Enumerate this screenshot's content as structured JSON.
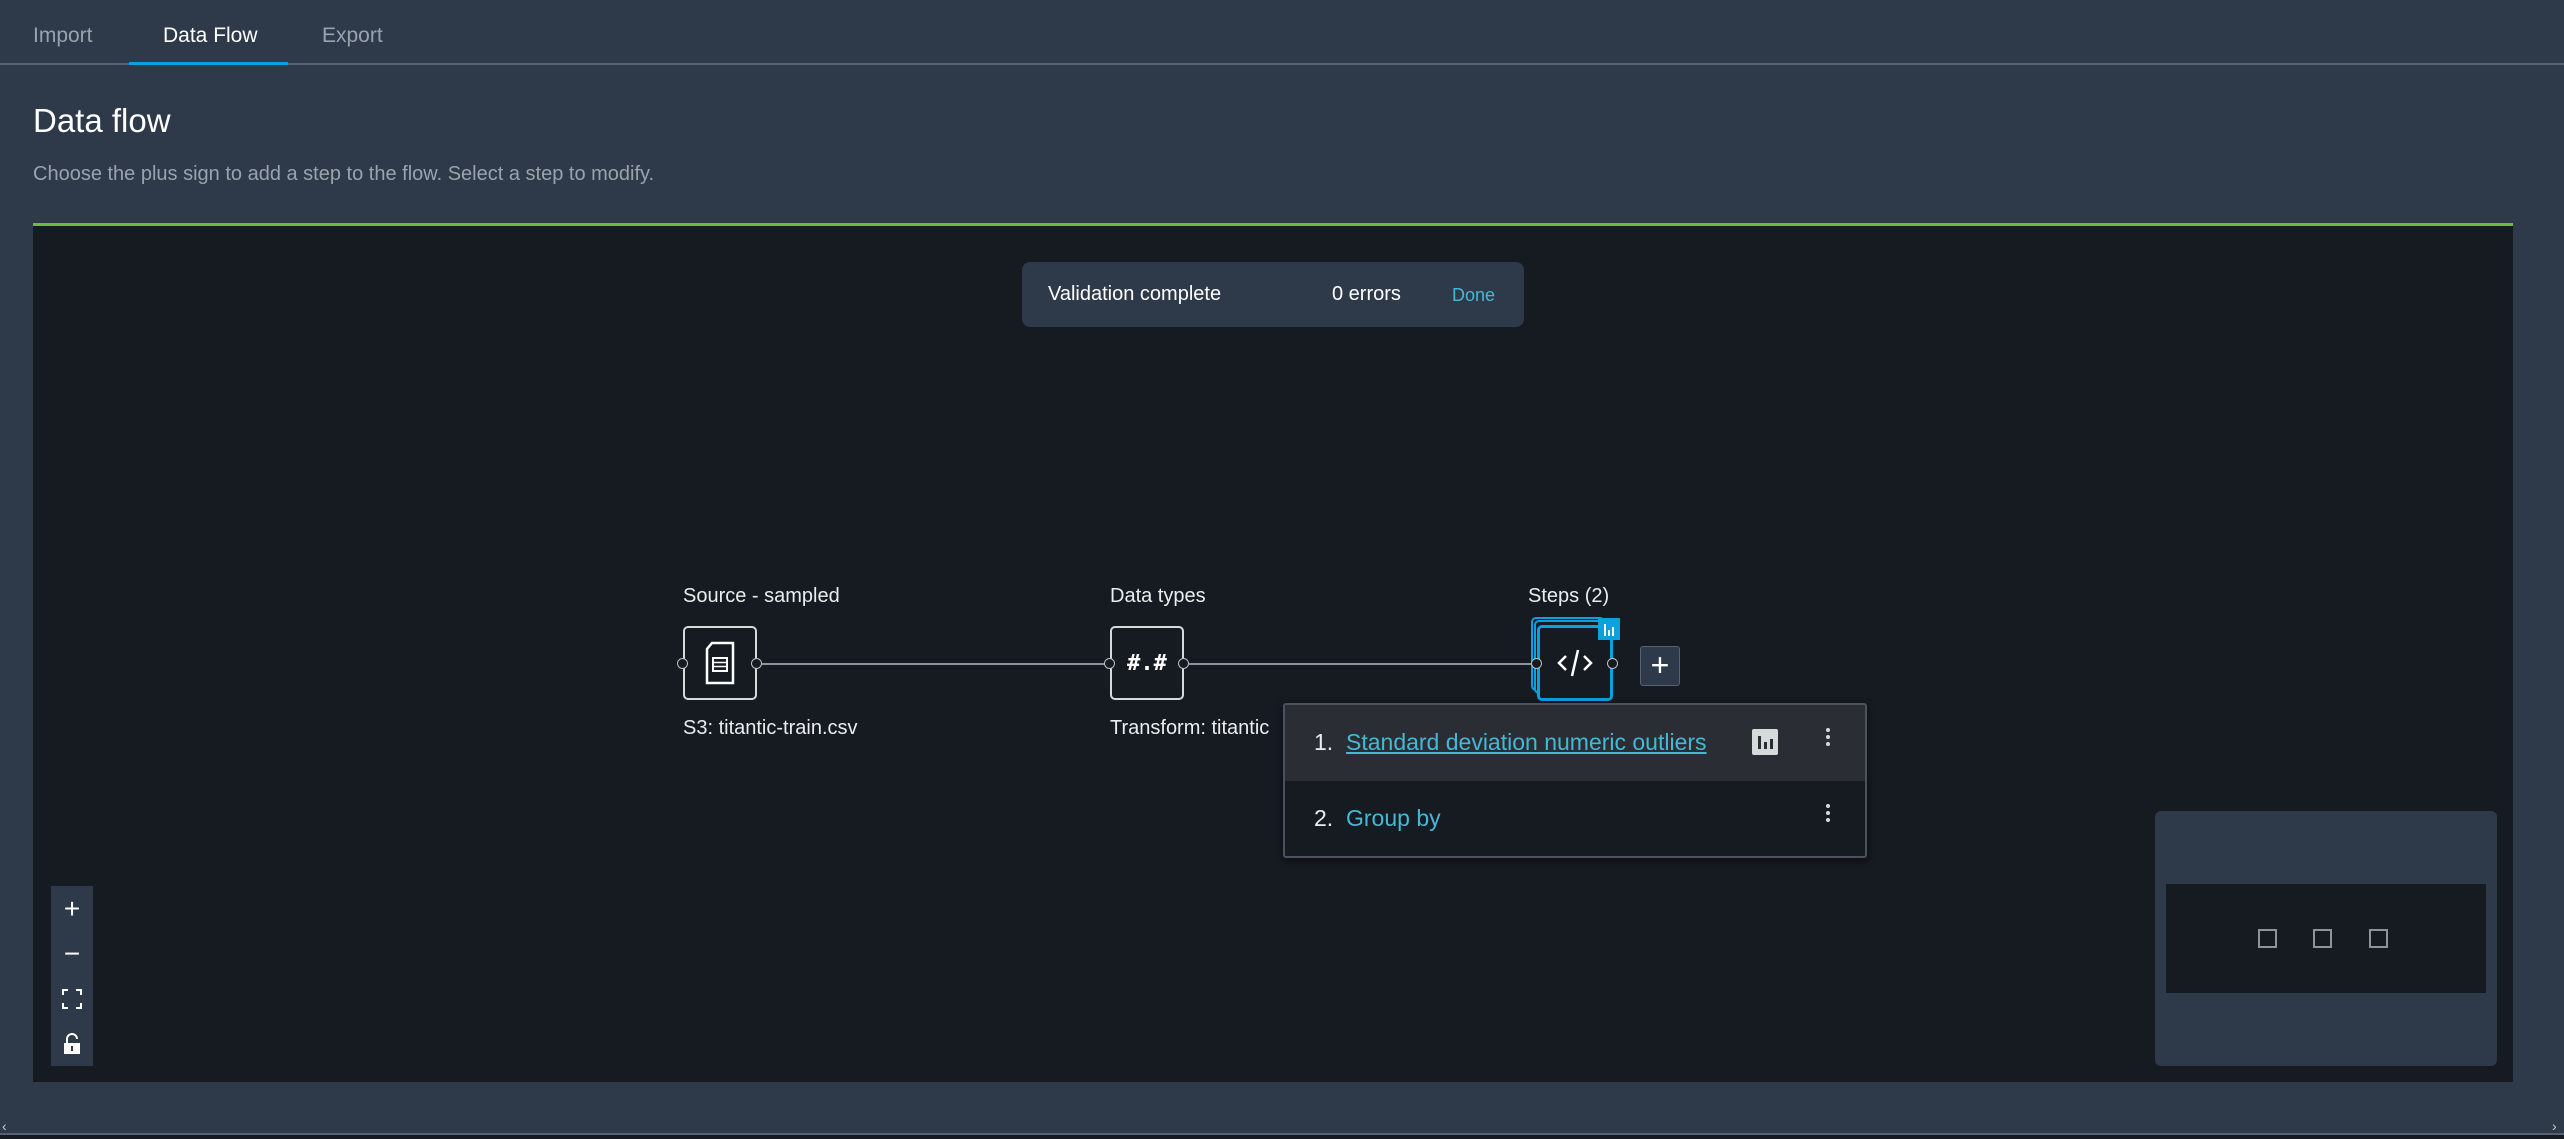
{
  "tabs": [
    {
      "label": "Import",
      "active": false
    },
    {
      "label": "Data Flow",
      "active": true
    },
    {
      "label": "Export",
      "active": false
    }
  ],
  "page": {
    "title": "Data flow",
    "subtitle": "Choose the plus sign to add a step to the flow. Select a step to modify."
  },
  "toast": {
    "message": "Validation complete",
    "errors": "0 errors",
    "done_label": "Done"
  },
  "nodes": [
    {
      "title": "Source - sampled",
      "caption": "S3: titantic-train.csv",
      "icon": "document-table-icon"
    },
    {
      "title": "Data types",
      "caption": "Transform: titantic",
      "icon": "#.#"
    },
    {
      "title": "Steps (2)",
      "icon": "code-icon"
    }
  ],
  "add_step_label": "+",
  "steps_popup": [
    {
      "number": "1.",
      "name": "Standard deviation numeric outliers",
      "has_chart": true
    },
    {
      "number": "2.",
      "name": "Group by",
      "has_chart": false
    }
  ],
  "zoom_controls": [
    "zoom-in",
    "zoom-out",
    "fit-view",
    "lock"
  ],
  "colors": {
    "accent": "#0aa1dd",
    "link": "#44b9d6",
    "success": "#6cbc3b",
    "canvas": "#161a21",
    "panel": "#2e3949"
  }
}
